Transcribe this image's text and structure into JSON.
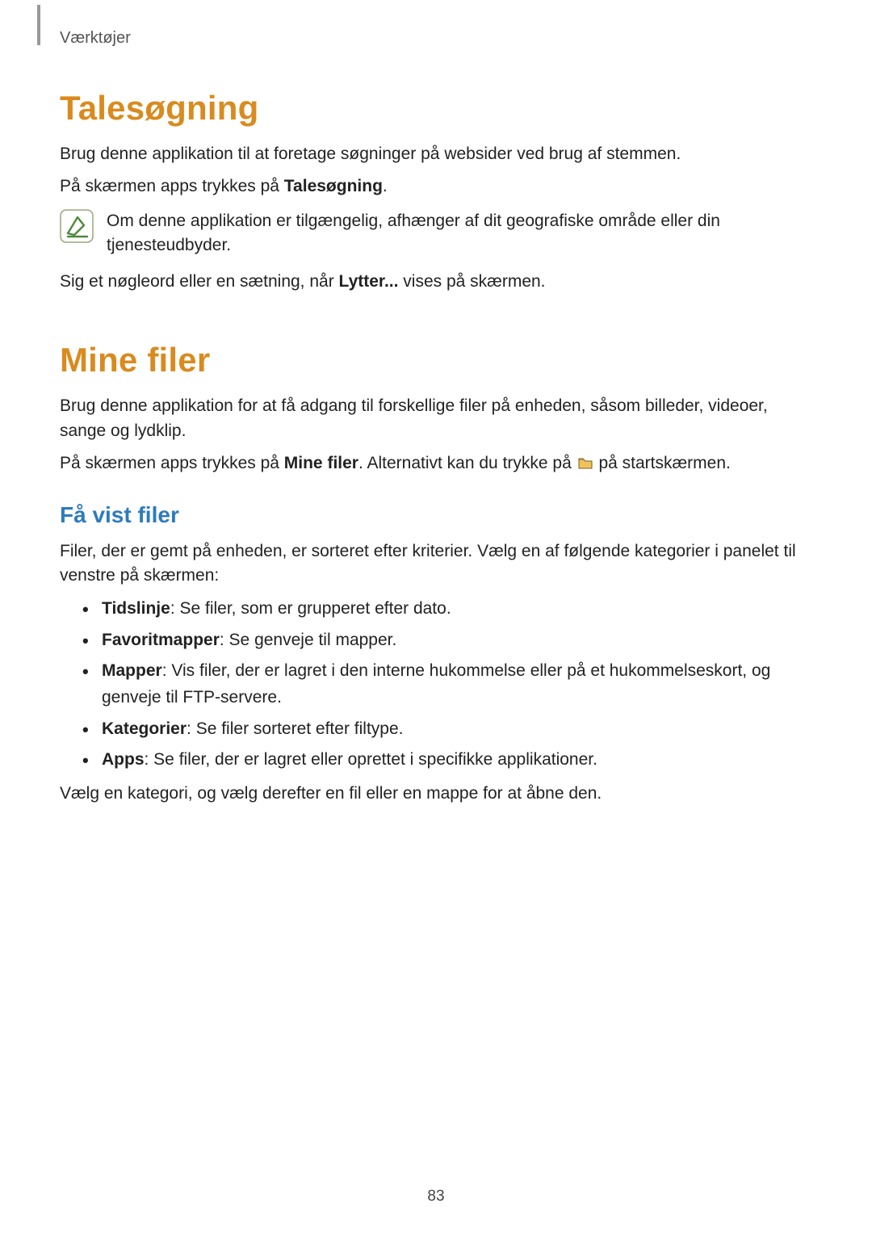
{
  "header": {
    "section_label": "Værktøjer"
  },
  "section1": {
    "title": "Talesøgning",
    "p1": "Brug denne applikation til at foretage søgninger på websider ved brug af stemmen.",
    "p2_pre": "På skærmen apps trykkes på ",
    "p2_bold": "Talesøgning",
    "p2_post": ".",
    "note": "Om denne applikation er tilgængelig, afhænger af dit geografiske område eller din tjenesteudbyder.",
    "p3_pre": "Sig et nøgleord eller en sætning, når ",
    "p3_bold": "Lytter...",
    "p3_post": " vises på skærmen."
  },
  "section2": {
    "title": "Mine filer",
    "p1": "Brug denne applikation for at få adgang til forskellige filer på enheden, såsom billeder, videoer, sange og lydklip.",
    "p2_pre": "På skærmen apps trykkes på ",
    "p2_bold": "Mine filer",
    "p2_mid": ". Alternativt kan du trykke på ",
    "p2_post": " på startskærmen.",
    "sub1": {
      "title": "Få vist filer",
      "intro": "Filer, der er gemt på enheden, er sorteret efter kriterier. Vælg en af følgende kategorier i panelet til venstre på skærmen:",
      "items": [
        {
          "lead": "Tidslinje",
          "rest": ": Se filer, som er grupperet efter dato."
        },
        {
          "lead": "Favoritmapper",
          "rest": ": Se genveje til mapper."
        },
        {
          "lead": "Mapper",
          "rest": ": Vis filer, der er lagret i den interne hukommelse eller på et hukommelseskort, og genveje til FTP-servere."
        },
        {
          "lead": "Kategorier",
          "rest": ": Se filer sorteret efter filtype."
        },
        {
          "lead": "Apps",
          "rest": ": Se filer, der er lagret eller oprettet i specifikke applikationer."
        }
      ],
      "outro": "Vælg en kategori, og vælg derefter en fil eller en mappe for at åbne den."
    }
  },
  "page_number": "83"
}
